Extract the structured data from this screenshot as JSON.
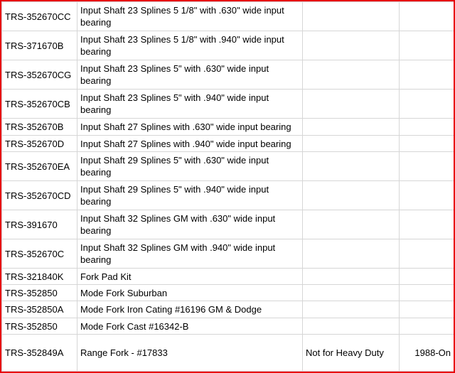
{
  "rows": [
    {
      "part": "TRS-352670CC",
      "description": "Input Shaft 23 Splines 5 1/8\"  with .630\" wide input bearing",
      "note": "",
      "year": ""
    },
    {
      "part": "TRS-371670B",
      "description": "Input Shaft 23 Splines 5 1/8\"  with .940\" wide input bearing",
      "note": "",
      "year": ""
    },
    {
      "part": "TRS-352670CG",
      "description": "Input Shaft  23 Splines 5\"  with .630\" wide input bearing",
      "note": "",
      "year": ""
    },
    {
      "part": "TRS-352670CB",
      "description": "Input Shaft 23 Splines 5\"  with .940\" wide input bearing",
      "note": "",
      "year": ""
    },
    {
      "part": "TRS-352670B",
      "description": "Input Shaft 27 Splines  with .630\" wide input bearing",
      "note": "",
      "year": ""
    },
    {
      "part": "TRS-352670D",
      "description": "Input Shaft 27 Splines  with .940\" wide input bearing",
      "note": "",
      "year": ""
    },
    {
      "part": "TRS-352670EA",
      "description": "Input Shaft  29 Splines 5\"  with .630\" wide input bearing",
      "note": "",
      "year": ""
    },
    {
      "part": "TRS-352670CD",
      "description": "Input Shaft  29 Splines 5\"  with .940\" wide input bearing",
      "note": "",
      "year": ""
    },
    {
      "part": "TRS-391670",
      "description": "Input Shaft 32 Splines  GM with .630\" wide input bearing",
      "note": "",
      "year": ""
    },
    {
      "part": "TRS-352670C",
      "description": "Input Shaft 32 Splines  GM with .940\" wide input bearing",
      "note": "",
      "year": ""
    },
    {
      "part": "TRS-321840K",
      "description": "Fork Pad Kit",
      "note": "",
      "year": ""
    },
    {
      "part": "TRS-352850",
      "description": "Mode Fork Suburban",
      "note": "",
      "year": ""
    },
    {
      "part": "TRS-352850A",
      "description": "Mode Fork Iron Cating #16196 GM & Dodge",
      "note": "",
      "year": ""
    },
    {
      "part": "TRS-352850",
      "description": "Mode Fork Cast #16342-B",
      "note": "",
      "year": ""
    },
    {
      "part": "TRS-352849A",
      "description": "Range Fork - #17833",
      "note": "Not for Heavy Duty",
      "year": "1988-On"
    }
  ],
  "colors": {
    "frame_border": "#e8000b",
    "grid_line": "#d6d6d6",
    "background": "#ffffff",
    "text": "#000000"
  }
}
